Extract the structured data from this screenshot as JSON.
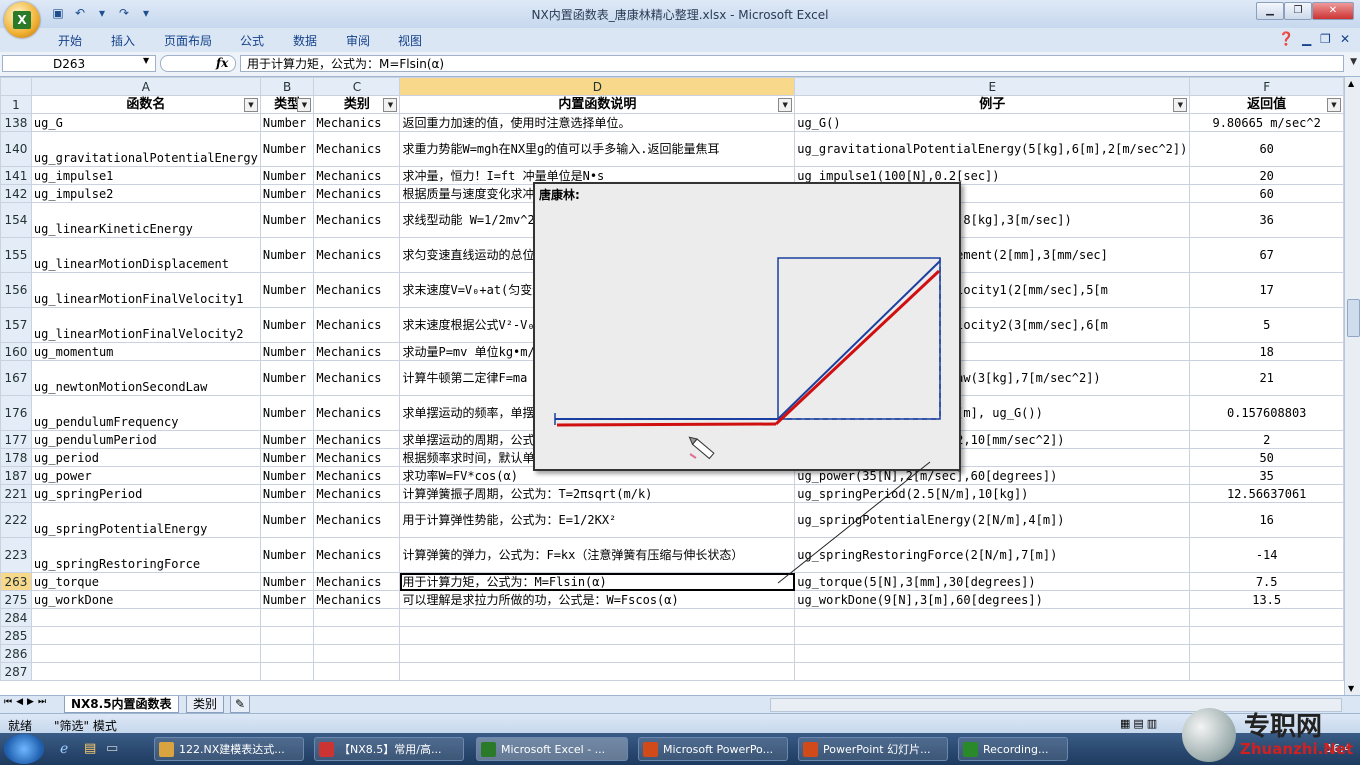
{
  "app": {
    "window_title": "NX内置函数表_唐康林精心整理.xlsx - Microsoft Excel",
    "office_button_letter": "X"
  },
  "ribbon_tabs": [
    "开始",
    "插入",
    "页面布局",
    "公式",
    "数据",
    "审阅",
    "视图"
  ],
  "formula_bar": {
    "name_box": "D263",
    "fx": "fx",
    "formula": "用于计算力矩，公式为：M=Flsin(α)"
  },
  "columns": [
    "A",
    "B",
    "C",
    "D",
    "E",
    "F"
  ],
  "header_row": {
    "row_num": "1",
    "cells": [
      "函数名",
      "类型",
      "类别",
      "内置函数说明",
      "例子",
      "返回值"
    ]
  },
  "rows": [
    {
      "n": "138",
      "a": "ug_G",
      "b": "Number",
      "c": "Mechanics",
      "d": "返回重力加速的值，使用时注意选择单位。",
      "e": "ug_G()",
      "f": "9.80665 m/sec^2",
      "h": 18
    },
    {
      "n": "140",
      "a": "ug_gravitationalPotentialEnergy",
      "b": "Number",
      "c": "Mechanics",
      "d": "求重力势能W=mgh在NX里g的值可以手多输入.返回能量焦耳",
      "e": "ug_gravitationalPotentialEnergy(5[kg],6[m],2[m/sec^2])",
      "f": "60",
      "h": 35
    },
    {
      "n": "141",
      "a": "ug_impulse1",
      "b": "Number",
      "c": "Mechanics",
      "d": "求冲量，恒力！I=ft 冲量单位是N•s",
      "e": "ug_impulse1(100[N],0.2[sec])",
      "f": "20",
      "h": 18
    },
    {
      "n": "142",
      "a": "ug_impulse2",
      "b": "Number",
      "c": "Mechanics",
      "d": "根据质量与速度变化求冲量",
      "e": "ug_impulse2(…[sec])",
      "f": "60",
      "h": 18
    },
    {
      "n": "154",
      "a": "ug_linearKineticEnergy",
      "b": "Number",
      "c": "Mechanics",
      "d": "求线型动能 W=1/2mv^2 单位",
      "e": "ug_linearKineticEnergy(8[kg],3[m/sec])",
      "f": "36",
      "h": 35
    },
    {
      "n": "155",
      "a": "ug_linearMotionDisplacement",
      "b": "Number",
      "c": "Mechanics",
      "d": "求匀变速直线运动的总位移",
      "e": "ug_linearMotionDisplacement(2[mm],3[mm/sec]",
      "f": "67",
      "h": 35
    },
    {
      "n": "156",
      "a": "ug_linearMotionFinalVelocity1",
      "b": "Number",
      "c": "Mechanics",
      "d": "求末速度V=V₀+at(匀变速直线",
      "e": "ug_linearMotionFinalVelocity1(2[mm/sec],5[m",
      "f": "17",
      "h": 35
    },
    {
      "n": "157",
      "a": "ug_linearMotionFinalVelocity2",
      "b": "Number",
      "c": "Mechanics",
      "d": "求末速度根据公式V²-V₀²=2a",
      "e": "ug_linearMotionFinalVelocity2(3[mm/sec],6[m",
      "f": "5",
      "h": 35
    },
    {
      "n": "160",
      "a": "ug_momentum",
      "b": "Number",
      "c": "Mechanics",
      "d": "求动量P=mv 单位kg•m/s",
      "e": "ug_momentum(…sec])",
      "f": "18",
      "h": 18
    },
    {
      "n": "167",
      "a": "ug_newtonMotionSecondLaw",
      "b": "Number",
      "c": "Mechanics",
      "d": "计算牛顿第二定律F=ma 返回",
      "e": "ug_newtonMotionSecondLaw(3[kg],7[m/sec^2])",
      "f": "21",
      "h": 35
    },
    {
      "n": "176",
      "a": "ug_pendulumFrequency",
      "b": "Number",
      "c": "Mechanics",
      "d": "求单摆运动的频率，单摆周期",
      "e": "ug_pendulumFrequency(…[m], ug_G())",
      "f": "0.157608803",
      "h": 35
    },
    {
      "n": "177",
      "a": "ug_pendulumPeriod",
      "b": "Number",
      "c": "Mechanics",
      "d": "求单摆运动的周期，公式为",
      "e": "ug_pendulumPeriod(…()^2,10[mm/sec^2])",
      "f": "2",
      "h": 18
    },
    {
      "n": "178",
      "a": "ug_period",
      "b": "Number",
      "c": "Mechanics",
      "d": "根据频率求时间，默认单位一般",
      "e": "ug_period(…)",
      "f": "50",
      "h": 18
    },
    {
      "n": "187",
      "a": "ug_power",
      "b": "Number",
      "c": "Mechanics",
      "d": "求功率W=FV*cos(α)",
      "e": "ug_power(35[N],2[m/sec],60[degrees])",
      "f": "35",
      "h": 18
    },
    {
      "n": "221",
      "a": "ug_springPeriod",
      "b": "Number",
      "c": "Mechanics",
      "d": "计算弹簧振子周期，公式为：T=2πsqrt(m/k)",
      "e": "ug_springPeriod(2.5[N/m],10[kg])",
      "f": "12.56637061",
      "h": 18
    },
    {
      "n": "222",
      "a": "ug_springPotentialEnergy",
      "b": "Number",
      "c": "Mechanics",
      "d": "用于计算弹性势能，公式为：E=1/2KX²",
      "e": "ug_springPotentialEnergy(2[N/m],4[m])",
      "f": "16",
      "h": 35
    },
    {
      "n": "223",
      "a": "ug_springRestoringForce",
      "b": "Number",
      "c": "Mechanics",
      "d": "计算弹簧的弹力，公式为：F=kx（注意弹簧有压缩与伸长状态）",
      "e": "ug_springRestoringForce(2[N/m],7[m])",
      "f": "-14",
      "h": 35
    },
    {
      "n": "263",
      "a": "ug_torque",
      "b": "Number",
      "c": "Mechanics",
      "d": "用于计算力矩，公式为：M=Flsin(α)",
      "e": "ug_torque(5[N],3[mm],30[degrees])",
      "f": "7.5",
      "h": 18
    },
    {
      "n": "275",
      "a": "ug_workDone",
      "b": "Number",
      "c": "Mechanics",
      "d": "可以理解是求拉力所做的功，公式是：W=Fscos(α)",
      "e": "ug_workDone(9[N],3[m],60[degrees])",
      "f": "13.5",
      "h": 18
    }
  ],
  "empty_rows": [
    "284",
    "285",
    "286",
    "287"
  ],
  "sheet_tabs": [
    "NX8.5内置函数表",
    "类别"
  ],
  "status": {
    "ready": "就绪",
    "mode": "\"筛选\" 模式"
  },
  "popup": {
    "title": "唐康林:"
  },
  "taskbar": {
    "items": [
      "122.NX建模表达式...",
      "【NX8.5】常用/高...",
      "Microsoft Excel - ...",
      "Microsoft PowerPo...",
      "PowerPoint 幻灯片...",
      "Recording..."
    ],
    "clock": "16:4"
  },
  "watermark": {
    "cn": "专职网",
    "en": "Zhuanzhi.Net"
  },
  "colors": {
    "selection": "#f8d88a",
    "red_line": "#d01010",
    "blue_line": "#1a3fa0"
  }
}
